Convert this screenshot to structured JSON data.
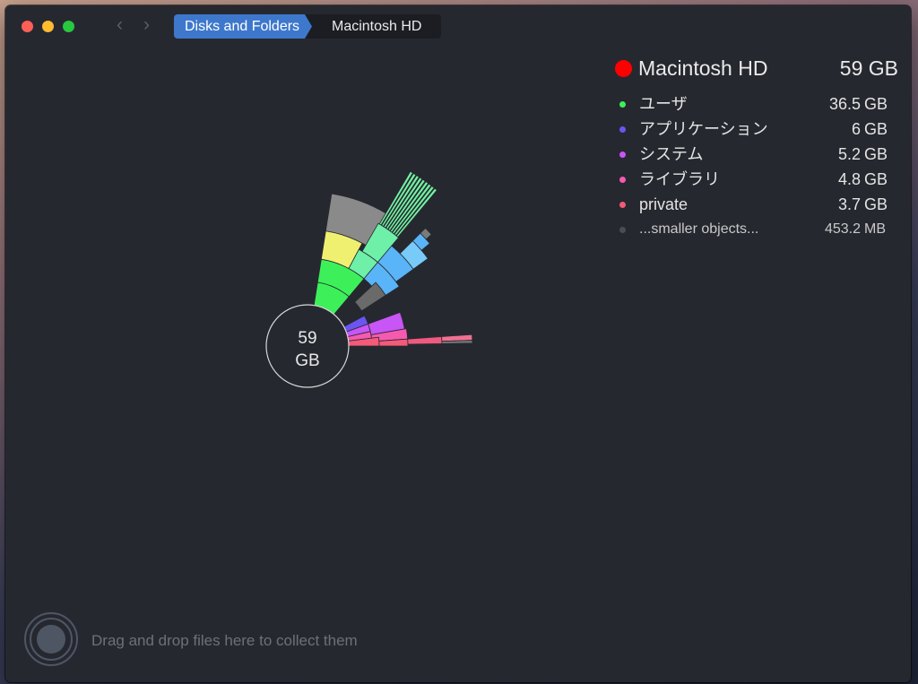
{
  "window": {
    "breadcrumb": [
      {
        "label": "Disks and Folders"
      },
      {
        "label": "Macintosh HD"
      }
    ]
  },
  "chart_data": {
    "type": "sunburst",
    "center_value": "59",
    "center_unit": "GB",
    "root": {
      "name": "Macintosh HD",
      "size": "59 GB",
      "color": "#ff0000"
    },
    "segments": [
      {
        "name": "ユーザ",
        "value": 36.5,
        "unit": "GB",
        "color": "#3df05a"
      },
      {
        "name": "アプリケーション",
        "value": 6,
        "unit": "GB",
        "color": "#6b55f0"
      },
      {
        "name": "システム",
        "value": 5.2,
        "unit": "GB",
        "color": "#c855f5"
      },
      {
        "name": "ライブラリ",
        "value": 4.8,
        "unit": "GB",
        "color": "#f55ab0"
      },
      {
        "name": "private",
        "value": 3.7,
        "unit": "GB",
        "color": "#f55a78"
      },
      {
        "name": "...smaller objects...",
        "value": 453.2,
        "unit": "MB",
        "color": "#4a4d55"
      }
    ]
  },
  "dropzone": {
    "text": "Drag and drop files here to collect them"
  }
}
